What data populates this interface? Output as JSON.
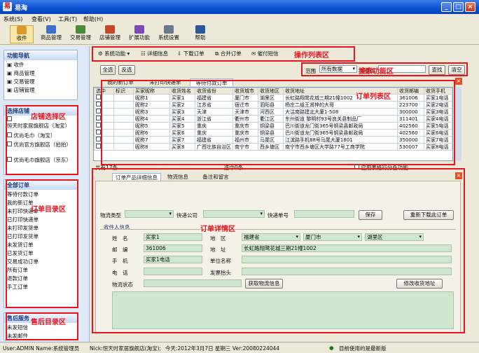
{
  "window": {
    "title": "易淘",
    "minimize": "_",
    "maximize": "□",
    "close": "×"
  },
  "menu": [
    "系统(S)",
    "查看(V)",
    "工具(T)",
    "帮助(H)"
  ],
  "toolbar": [
    "收件",
    "商品管理",
    "交易管理",
    "店铺管理",
    "扩展功能",
    "系统设置",
    "帮助"
  ],
  "left": {
    "nav_title": "功能导航",
    "nav_items": [
      "收件",
      "商品管理",
      "交易管理",
      "店铺管理"
    ],
    "shop_title": "选择店铺",
    "shops": [
      "恒天时家居旗舰店（淘宝）",
      "优尚毛巾（淘宝）",
      "优尚官方旗舰店（拍拍）",
      "优尚毛巾旗舰店（京东）"
    ],
    "orders_title": "全部订单",
    "order_items": [
      "等待付款订单",
      "我的新订单",
      "未打印快递单",
      "已打印快递单",
      "未打印发货单",
      "已打印发货单",
      "未发货订单",
      "已发货订单",
      "交易成功订单",
      "所有订单",
      "退款订单",
      "手工订单"
    ],
    "after_title": "售后服务",
    "after_items": [
      "未发短信",
      "未发邮件"
    ]
  },
  "annotations": {
    "shop": "店铺选择区",
    "orders": "订单目录区",
    "after": "售后目录区",
    "actions": "操作列表区",
    "search": "搜索功能区",
    "list": "订单列表区",
    "detail": "订单详情区"
  },
  "actions": [
    "系统功能",
    "详细信息",
    "下载订单",
    "合并订单",
    "催付短信"
  ],
  "search": {
    "select_all": "全选",
    "invert": "反选",
    "range_label": "范围",
    "range_value": "所有数据",
    "keyword_label": "关键词",
    "find": "查找",
    "clear": "清空"
  },
  "tabs": [
    "我的新订单",
    "未打印快递单",
    "等待付款订单"
  ],
  "columns": [
    "选中",
    "标识",
    "买家昵称",
    "收货姓名",
    "收货省份",
    "收货城市",
    "收货地区",
    "收货地址",
    "收货邮编",
    "收货手机"
  ],
  "rows": [
    [
      "昵称1",
      "买家1",
      "福建省",
      "厦门市",
      "湖里区",
      "长虹路翔鹭花城三期21幢1002",
      "361006",
      "买家1电话"
    ],
    [
      "昵称2",
      "买家2",
      "江苏省",
      "宿迁市",
      "泗阳县",
      "杨庄二组王贤梓的大哥",
      "223700",
      "买家2电话"
    ],
    [
      "昵称3",
      "买家3",
      "天津",
      "天津市",
      "河西区",
      "大沽南路建北大厦1-508",
      "300000",
      "买家3电话"
    ],
    [
      "昵称4",
      "买家4",
      "浙江省",
      "衢州市",
      "衢江区",
      "东州街道 黎明村93号良关县制品厂",
      "311401",
      "买家4电话"
    ],
    [
      "昵称5",
      "买家5",
      "重庆",
      "重庆市",
      "铜梁县",
      "巴川街道龙门街365号铜梁县邮政局",
      "402560",
      "买家5电话"
    ],
    [
      "昵称6",
      "买家6",
      "重庆",
      "重庆市",
      "铜梁县",
      "巴川街道龙门街365号铜梁县邮政局",
      "402560",
      "买家6电话"
    ],
    [
      "昵称7",
      "买家7",
      "福建省",
      "福州市",
      "马尾区",
      "江滨路手机88号马尾大厦1801",
      "350000",
      "买家7电话"
    ],
    [
      "昵称8",
      "买家8",
      "广西壮族自治区",
      "南宁市",
      "西乡塘区",
      "南宁市西乡塘区大学路77号工商学院",
      "530007",
      "买家8电话"
    ]
  ],
  "grid_footer": {
    "total": "共有17条",
    "selected": "选中0条",
    "color_option": "启用表格行分色功能"
  },
  "detail_tabs": [
    "订单产品详细信息",
    "物流信息",
    "备注和留言"
  ],
  "detail": {
    "ship_type_label": "物流类型",
    "courier_label": "快递公司",
    "tracking_label": "快递单号",
    "save": "保存",
    "redownload": "重新下载此订单",
    "section": "收件人信息",
    "name_label": "姓　名",
    "name_value": "买家1",
    "region_label": "地　区",
    "province": "福建省",
    "city": "厦门市",
    "district": "湖里区",
    "postcode_label": "邮　编",
    "postcode_value": "361006",
    "address_label": "地　址",
    "address_value": "长虹路翔鹭花城三期21幢1002",
    "mobile_label": "手　机",
    "mobile_value": "买家1电话",
    "company_label": "单位名称",
    "phone_label": "电　话",
    "invoice_label": "发票抬头",
    "logistics_label": "物流状态",
    "fetch_logistics": "获取物流信息",
    "modify_address": "修改收货地址"
  },
  "status": {
    "user": "User:ADMIN Name:系统管理员",
    "nick": "Nick:恒天时家居旗舰店(淘宝);",
    "date": "今天:2012年3月7日 星期三 Ver:20080224044",
    "latest": "目前使用的是最新版"
  }
}
